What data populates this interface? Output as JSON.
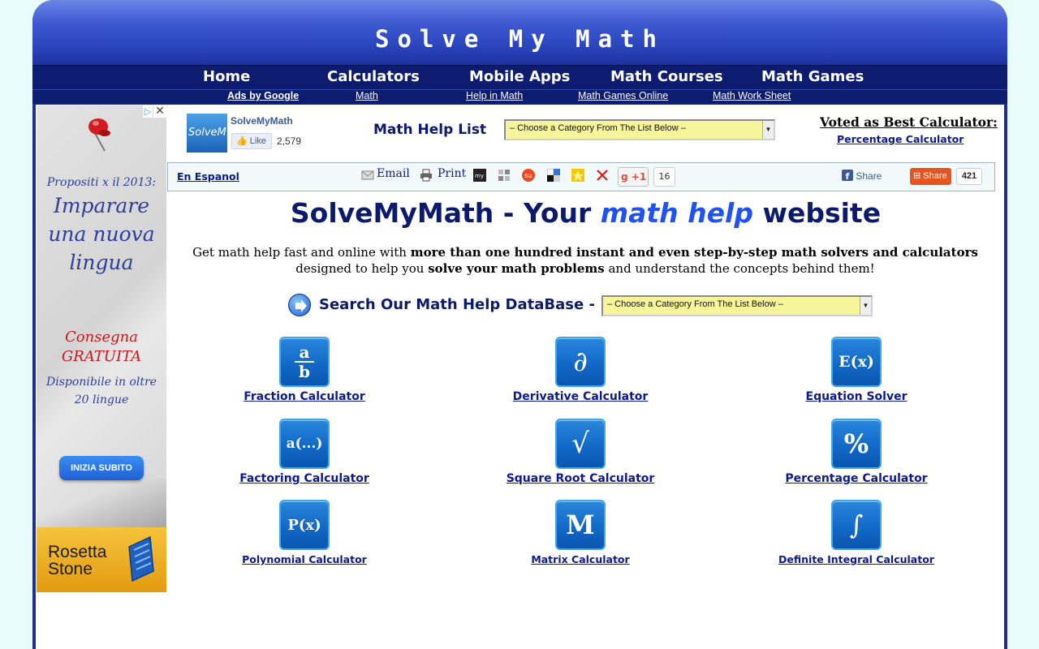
{
  "site": {
    "title": "Solve My Math"
  },
  "main_nav": [
    {
      "label": "Home"
    },
    {
      "label": "Calculators"
    },
    {
      "label": "Mobile Apps"
    },
    {
      "label": "Math Courses"
    },
    {
      "label": "Math Games"
    }
  ],
  "sub_nav": [
    {
      "label": "Ads by Google"
    },
    {
      "label": "Math"
    },
    {
      "label": "Help in Math"
    },
    {
      "label": "Math Games Online"
    },
    {
      "label": "Math Work Sheet"
    }
  ],
  "ad": {
    "headline_line1": "Propositi x il 2013:",
    "headline_line2": "Imparare",
    "headline_line3": "una nuova",
    "headline_line4": "lingua",
    "delivery_line1": "Consegna",
    "delivery_line2": "GRATUITA",
    "availability_line1": "Disponibile in oltre",
    "availability_line2": "20 lingue",
    "cta": "INIZIA SUBITO",
    "brand_line1": "Rosetta",
    "brand_line2": "Stone",
    "close_glyph": "✕",
    "choices_glyph": "▷"
  },
  "facebook_box": {
    "logo_text": "SolveM",
    "name": "SolveMyMath",
    "like_label": "Like",
    "like_count": "2,579"
  },
  "help_list": {
    "label": "Math Help List",
    "select_value": "– Choose a Category From The List Below –"
  },
  "award": {
    "title": "Voted as Best Calculator:",
    "link": "Percentage Calculator"
  },
  "share_bar": {
    "espanol": "En Espanol",
    "email": "Email",
    "print": "Print",
    "gplus_label": "+1",
    "gplus_count": "16",
    "fb_share": "Share",
    "addthis_share": "Share",
    "addthis_count": "421"
  },
  "headline": {
    "part1": "SolveMyMath - Your ",
    "emphasis": "math help",
    "part2": " website"
  },
  "intro": {
    "t1": "Get math help fast and online with ",
    "b1": "more than one hundred instant and even step-by-step math solvers and calculators",
    "t2": " designed to help you ",
    "b2": "solve your math problems",
    "t3": " and understand the concepts behind them!"
  },
  "search": {
    "label": "Search Our Math Help DataBase -",
    "select_value": "– Choose a Category From The List Below –"
  },
  "tools": [
    {
      "label": "Fraction Calculator",
      "icon": "fraction-icon",
      "glyph": "a/b"
    },
    {
      "label": "Derivative Calculator",
      "icon": "derivative-icon",
      "glyph": "∂"
    },
    {
      "label": "Equation Solver",
      "icon": "equation-icon",
      "glyph": "E(x)"
    },
    {
      "label": "Factoring Calculator",
      "icon": "factoring-icon",
      "glyph": "a(...)"
    },
    {
      "label": "Square Root Calculator",
      "icon": "square-root-icon",
      "glyph": "√"
    },
    {
      "label": "Percentage Calculator",
      "icon": "percentage-icon",
      "glyph": "%"
    },
    {
      "label": "Polynomial Calculator",
      "icon": "polynomial-icon",
      "glyph": "P(x)"
    },
    {
      "label": "Matrix Calculator",
      "icon": "matrix-icon",
      "glyph": "M"
    },
    {
      "label": "Definite Integral Calculator",
      "icon": "integral-icon",
      "glyph": "∫"
    }
  ],
  "colors": {
    "header_blue": "#2a45bd",
    "nav_navy": "#0d1c6f",
    "link_blue": "#0b1a8c",
    "select_yellow": "#f6f59a",
    "page_bg": "#e9fbfb"
  }
}
